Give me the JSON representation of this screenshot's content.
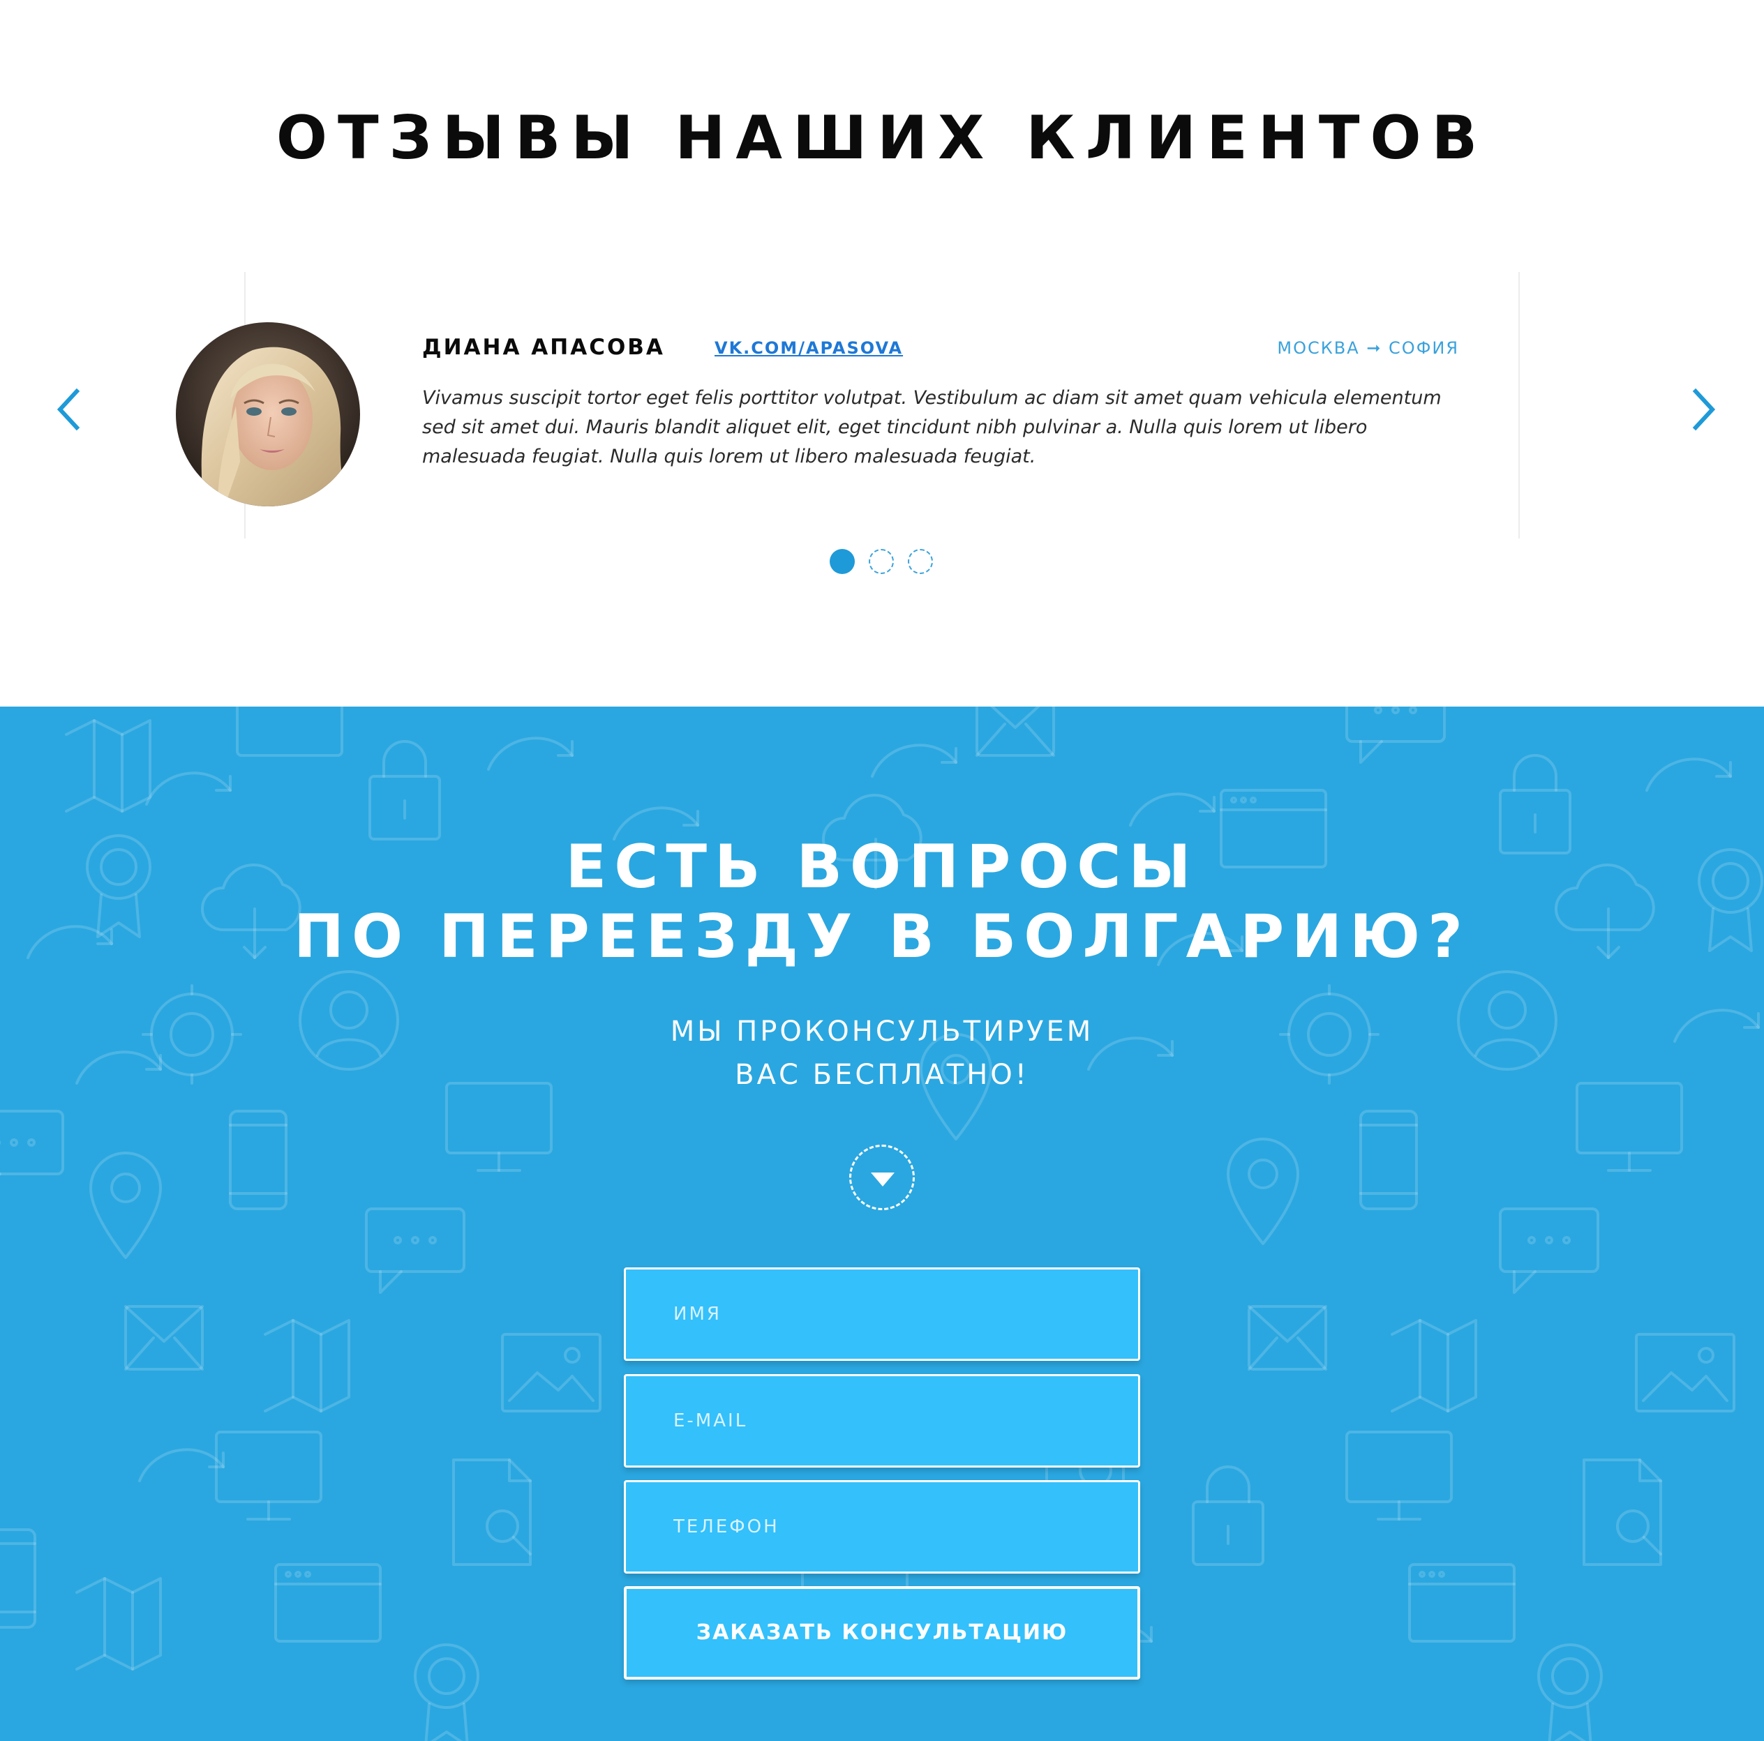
{
  "reviews": {
    "title": "ОТЗЫВЫ НАШИХ КЛИЕНТОВ",
    "current": {
      "name": "ДИАНА АПАСОВА",
      "link": "VK.COM/APASOVA",
      "route": "МОСКВА ➞ СОФИЯ",
      "text": "Vivamus suscipit tortor eget felis porttitor volutpat. Vestibulum ac diam sit amet quam vehicula elementum sed sit amet dui. Mauris blandit aliquet elit, eget tincidunt nibh pulvinar a. Nulla quis lorem ut libero malesuada feugiat. Nulla quis lorem ut libero malesuada feugiat."
    },
    "slides_total": 3,
    "active_slide": 1,
    "prev_icon": "chevron-left-icon",
    "next_icon": "chevron-right-icon"
  },
  "contact": {
    "title_line1": "ЕСТЬ ВОПРОСЫ",
    "title_line2": "ПО ПЕРЕЕЗДУ В БОЛГАРИЮ?",
    "subtitle_line1": "МЫ ПРОКОНСУЛЬТИРУЕМ",
    "subtitle_line2": "ВАС БЕСПЛАТНО!",
    "scroll_icon": "arrow-down-icon",
    "form": {
      "name_placeholder": "ИМЯ",
      "email_placeholder": "E-MAIL",
      "phone_placeholder": "ТЕЛЕФОН",
      "submit_label": "ЗАКАЗАТЬ КОНСУЛЬТАЦИЮ"
    }
  },
  "colors": {
    "accent": "#1e9ad8",
    "contact_bg": "#2aa7e0",
    "field_bg": "#33c0fb",
    "link": "#1e78d6"
  }
}
